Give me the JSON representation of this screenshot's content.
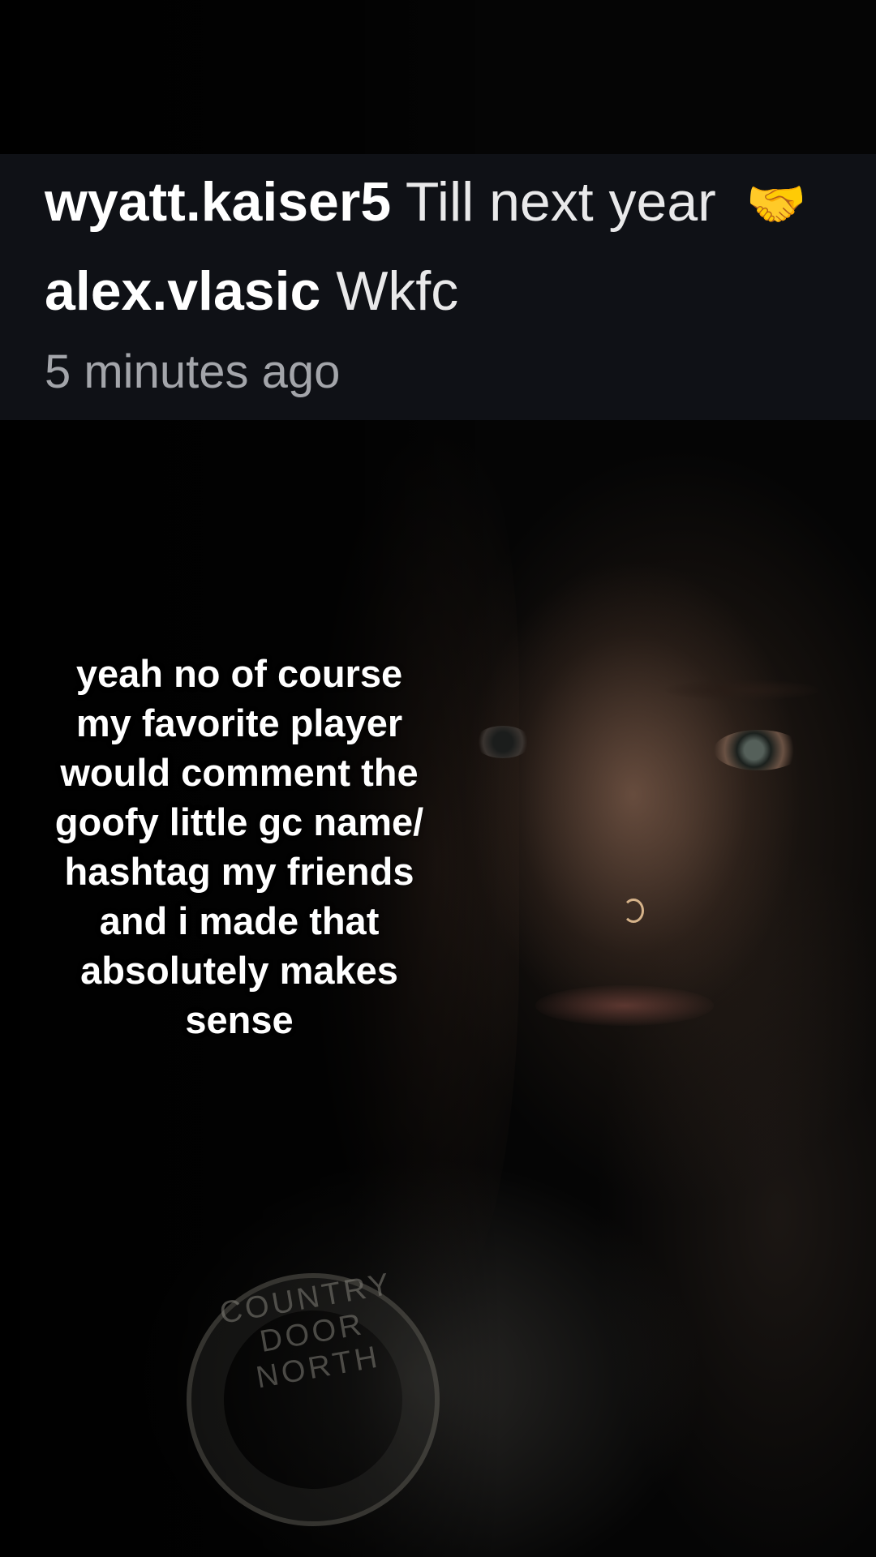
{
  "comment_overlay": {
    "comments": [
      {
        "username": "wyatt.kaiser5",
        "text": "Till next year",
        "emoji": "🤝"
      },
      {
        "username": "alex.vlasic",
        "text": "Wkfc"
      }
    ],
    "timestamp": "5 minutes ago"
  },
  "caption": {
    "text": "yeah no of course\nmy favorite player\nwould comment the\ngoofy little gc name/\nhashtag my friends\nand i made that\nabsolutely makes\nsense"
  },
  "background": {
    "shirt_print": "COUNTRY DOOR NORTH"
  }
}
